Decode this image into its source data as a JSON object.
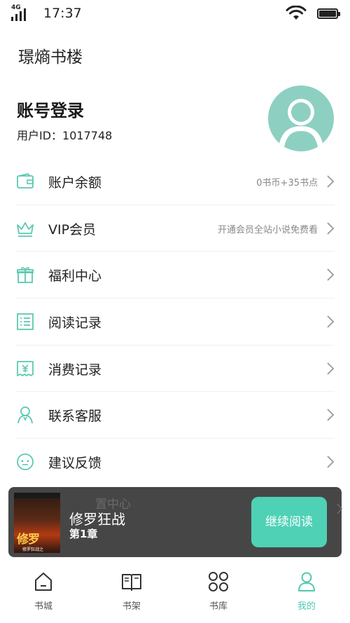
{
  "status_bar": {
    "network": "4G",
    "time": "17:37"
  },
  "app_title": "璟熵书楼",
  "account": {
    "title": "账号登录",
    "user_id": "用户ID：1017748"
  },
  "menu": [
    {
      "label": "账户余额",
      "value": "0书币+35书点",
      "icon": "wallet-icon",
      "name": "account-balance"
    },
    {
      "label": "VIP会员",
      "value": "开通会员全站小说免费看",
      "icon": "crown-icon",
      "name": "vip-member"
    },
    {
      "label": "福利中心",
      "value": "",
      "icon": "gift-icon",
      "name": "welfare-center"
    },
    {
      "label": "阅读记录",
      "value": "",
      "icon": "list-icon",
      "name": "reading-history"
    },
    {
      "label": "消费记录",
      "value": "",
      "icon": "receipt-icon",
      "name": "purchase-history"
    },
    {
      "label": "联系客服",
      "value": "",
      "icon": "support-agent-icon",
      "name": "contact-support"
    },
    {
      "label": "建议反馈",
      "value": "",
      "icon": "feedback-icon",
      "name": "feedback"
    }
  ],
  "reading_bar": {
    "book_title": "修罗狂战",
    "chapter": "第1章",
    "continue_label": "继续阅读",
    "partially_hidden_text": "置中心",
    "cover_title": "修罗",
    "cover_sub": "修罗狂战之"
  },
  "tabs": [
    {
      "label": "书城",
      "icon": "home-icon",
      "active": false
    },
    {
      "label": "书架",
      "icon": "book-icon",
      "active": false
    },
    {
      "label": "书库",
      "icon": "grid-icon",
      "active": false
    },
    {
      "label": "我的",
      "icon": "user-icon",
      "active": true
    }
  ],
  "colors": {
    "accent": "#4fd1b6",
    "icon_teal": "#5bc8b0",
    "avatar_bg": "#8dd0c2",
    "reading_bar_bg": "#464646"
  }
}
